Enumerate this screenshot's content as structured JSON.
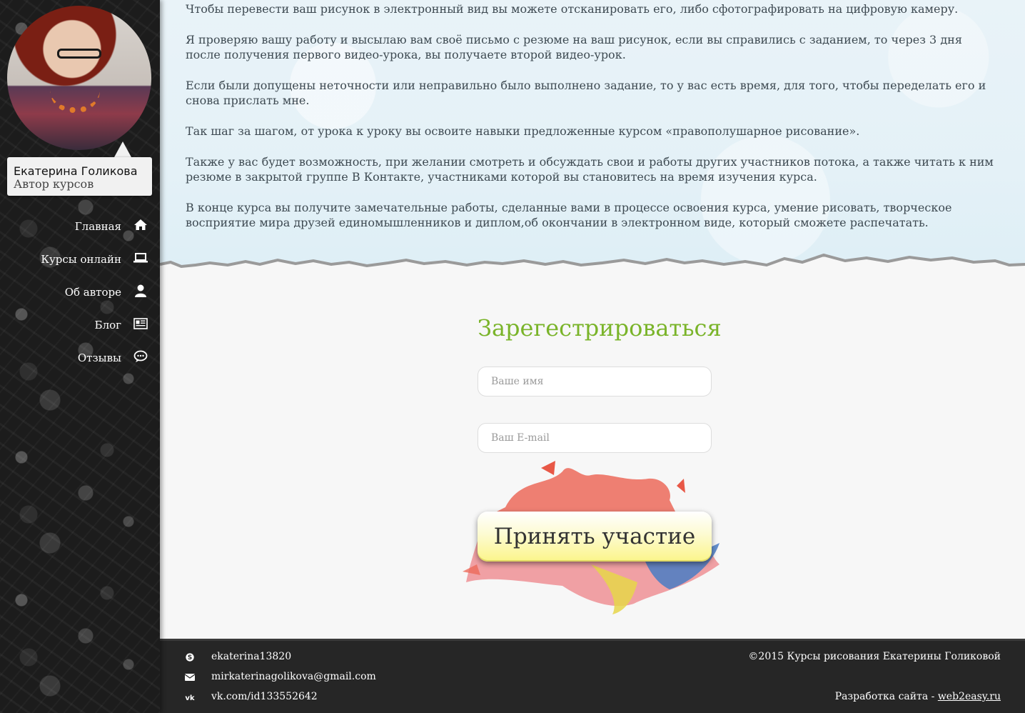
{
  "profile": {
    "name": "Екатерина Голикова",
    "role": "Автор курсов"
  },
  "nav": [
    {
      "label": "Главная",
      "icon": "home-icon"
    },
    {
      "label": "Курсы онлайн",
      "icon": "laptop-icon"
    },
    {
      "label": "Об авторе",
      "icon": "user-icon"
    },
    {
      "label": "Блог",
      "icon": "newspaper-icon"
    },
    {
      "label": "Отзывы",
      "icon": "comment-icon"
    }
  ],
  "content": {
    "paragraphs": [
      "Чтобы перевести ваш рисунок в электронный вид вы можете отсканировать его, либо сфотографировать на цифровую камеру.",
      "Я проверяю вашу работу и высылаю вам своё письмо с резюме на ваш рисунок, если вы справились с заданием, то через 3 дня после получения первого видео-урока, вы получаете второй видео-урок.",
      "Если были допущены неточности или неправильно было выполнено задание, то у вас есть время, для того, чтобы переделать его и снова прислать мне.",
      "Так шаг за шагом, от урока к уроку вы освоите навыки предложенные курсом «правополушарное рисование».",
      "Также у вас будет возможность, при желании смотреть и обсуждать свои и работы других участников потока, а также читать к ним резюме в закрытой группе В Контакте, участниками которой вы становитесь на время изучения курса.",
      "В конце курса вы получите замечательные работы, сделанные вами в процессе освоения курса, умение рисовать, творческое восприятие мира друзей единомышленников и диплом,об окончании в электронном виде, который сможете распечатать."
    ]
  },
  "register": {
    "title": "Зарегестрироваться",
    "name_placeholder": "Ваше имя",
    "email_placeholder": "Ваш E-mail",
    "submit_label": "Принять участие"
  },
  "footer": {
    "contacts": [
      {
        "icon": "skype-icon",
        "text": "ekaterina13820"
      },
      {
        "icon": "envelope-icon",
        "text": "mirkaterinagolikova@gmail.com"
      },
      {
        "icon": "vk-icon",
        "text": "vk.com/id133552642"
      }
    ],
    "copyright": "©2015 Курсы рисования Екатерины Голиковой",
    "dev_prefix": "Разработка сайта - ",
    "dev_link": "web2easy.ru"
  },
  "colors": {
    "accent_green": "#7ab42a",
    "button_yellow": "#fbf58a",
    "footer_bg": "#262626",
    "sidebar_bg": "#1c1c1c"
  }
}
